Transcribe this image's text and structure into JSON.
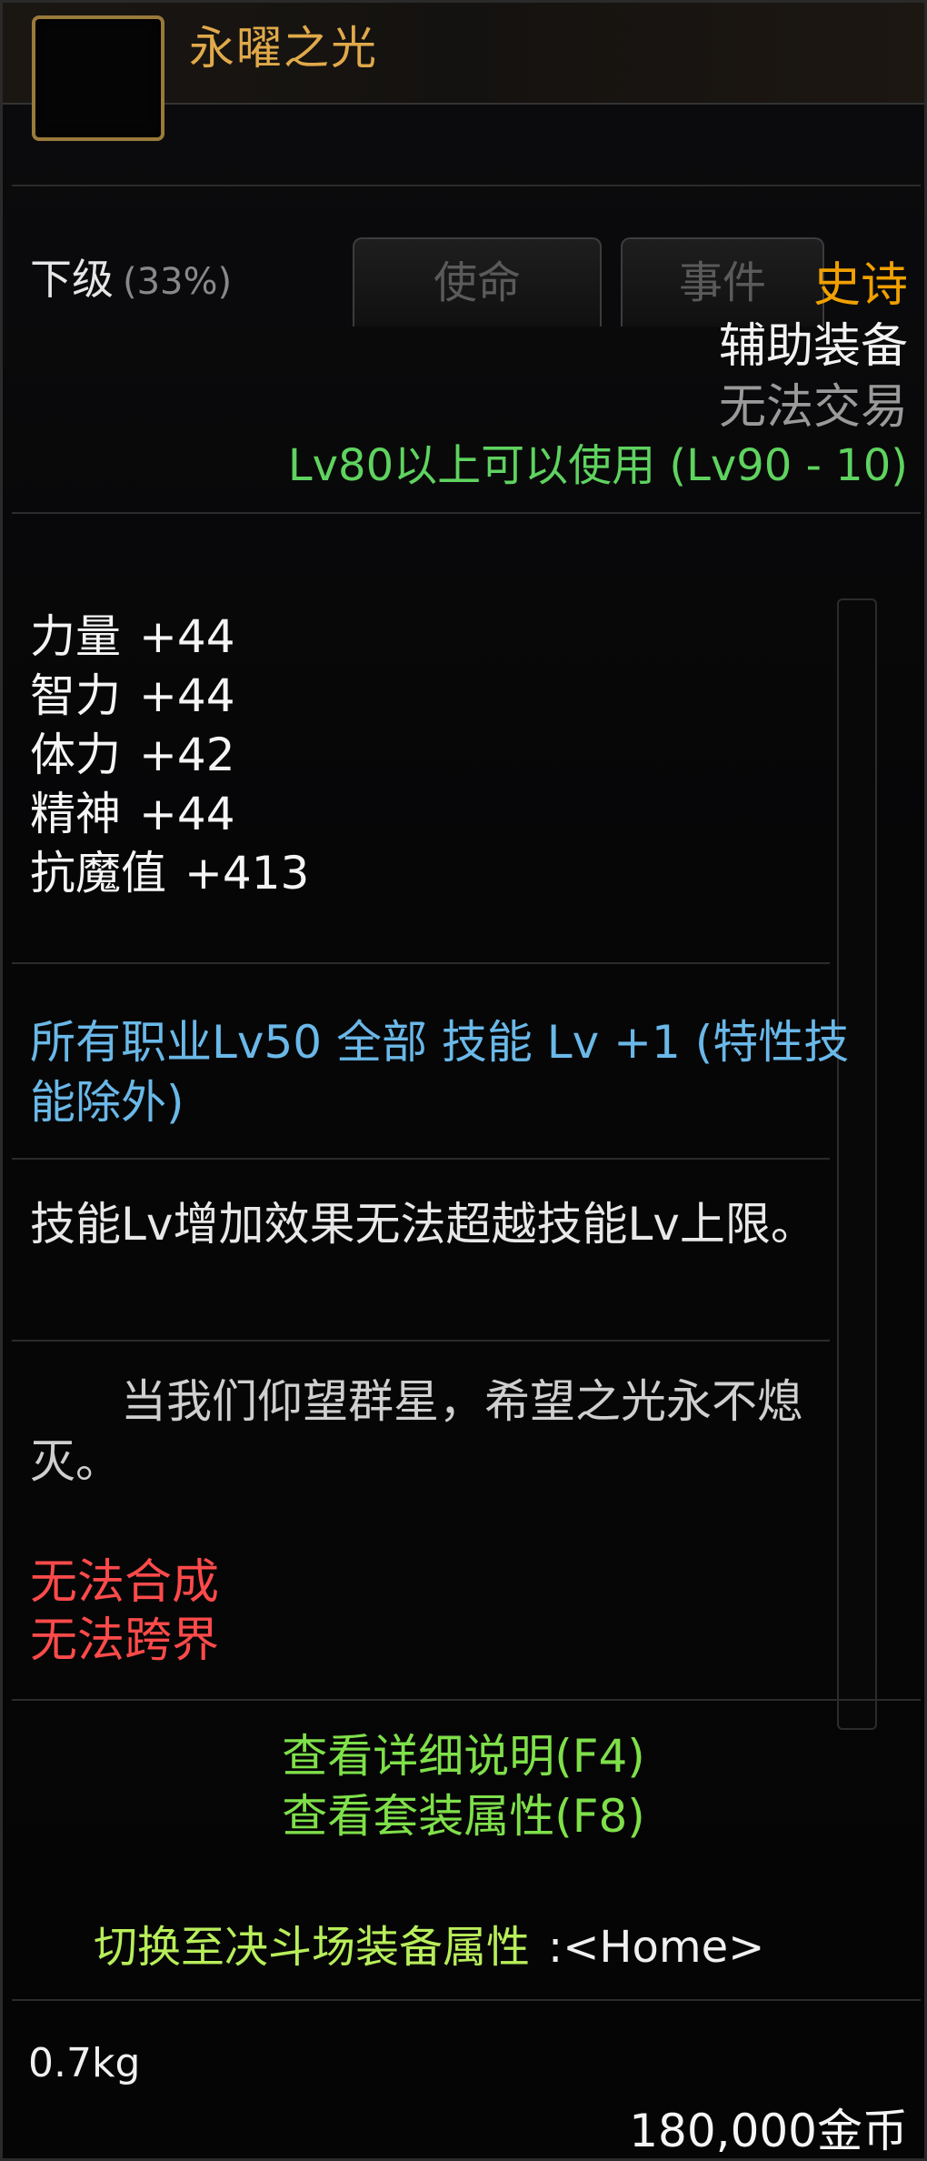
{
  "header": {
    "title": "永曜之光",
    "icon": "item-icon-slot"
  },
  "grade": {
    "label": "下级",
    "percent": "(33%)"
  },
  "tabs": [
    "使命",
    "事件"
  ],
  "info": {
    "rarity": "史诗",
    "type": "辅助装备",
    "trade": "无法交易",
    "level_req": "Lv80以上可以使用 (Lv90 - 10)"
  },
  "stats": [
    {
      "name": "力量",
      "value": "+44"
    },
    {
      "name": "智力",
      "value": "+44"
    },
    {
      "name": "体力",
      "value": "+42"
    },
    {
      "name": "精神",
      "value": "+44"
    },
    {
      "name": "抗魔值",
      "value": "+413"
    }
  ],
  "skill_bonus": "所有职业Lv50 全部 技能 Lv +1 (特性技能除外)",
  "skill_note": "技能Lv增加效果无法超越技能Lv上限。",
  "flavor": "当我们仰望群星，希望之光永不熄灭。",
  "restrictions": [
    "无法合成",
    "无法跨界"
  ],
  "links": {
    "detail": "查看详细说明(F4)",
    "set": "查看套装属性(F8)"
  },
  "switch": {
    "label": "切换至决斗场装备属性",
    "key": ":<Home>"
  },
  "footer": {
    "weight": "0.7kg",
    "price": "180,000金币"
  },
  "colors": {
    "title": "#e0a94a",
    "rarity_epic": "#f0a000",
    "level": "#5fd35f",
    "skill": "#6ab8e8",
    "restrict": "#ff4a4a",
    "link": "#7fe04a"
  }
}
